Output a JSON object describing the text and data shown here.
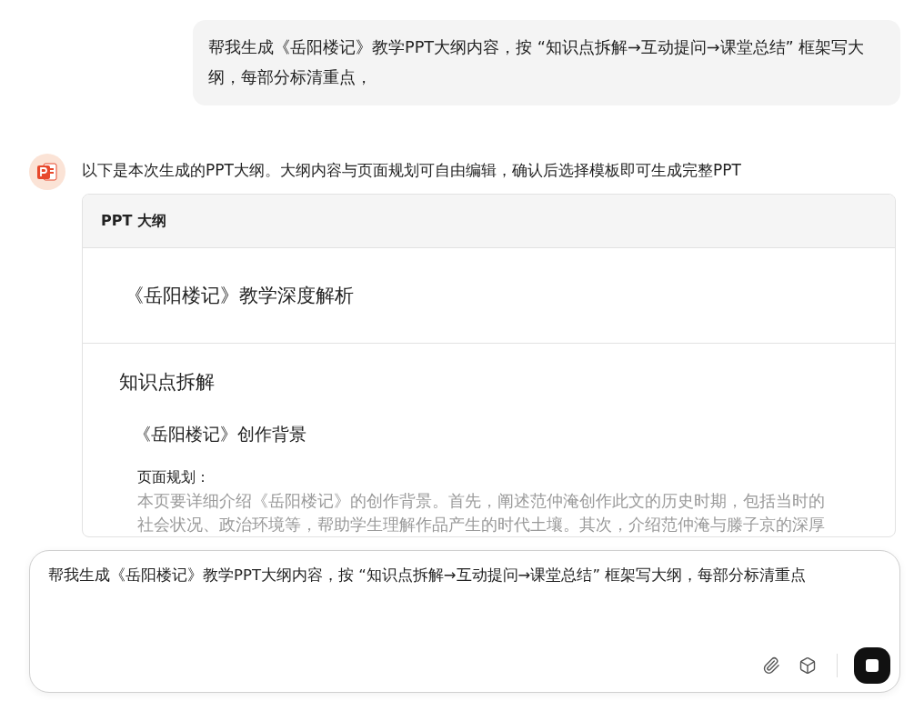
{
  "user_message": "帮我生成《岳阳楼记》教学PPT大纲内容，按 “知识点拆解→互动提问→课堂总结” 框架写大纲，每部分标清重点，",
  "assistant": {
    "intro": "以下是本次生成的PPT大纲。大纲内容与页面规划可自由编辑，确认后选择模板即可生成完整PPT",
    "outline": {
      "header": "PPT 大纲",
      "title": "《岳阳楼记》教学深度解析",
      "sections": [
        {
          "heading": "知识点拆解",
          "items": [
            {
              "heading": "《岳阳楼记》创作背景",
              "plan_label": "页面规划：",
              "plan_text": "本页要详细介绍《岳阳楼记》的创作背景。首先，阐述范仲淹创作此文的历史时期，包括当时的社会状况、政治环境等，帮助学生理解作品产生的时代土壤。其次，介绍范仲淹与滕子京的深厚"
            }
          ]
        }
      ]
    }
  },
  "composer": {
    "value": "帮我生成《岳阳楼记》教学PPT大纲内容，按 “知识点拆解→互动提问→课堂总结” 框架写大纲，每部分标清重点"
  }
}
